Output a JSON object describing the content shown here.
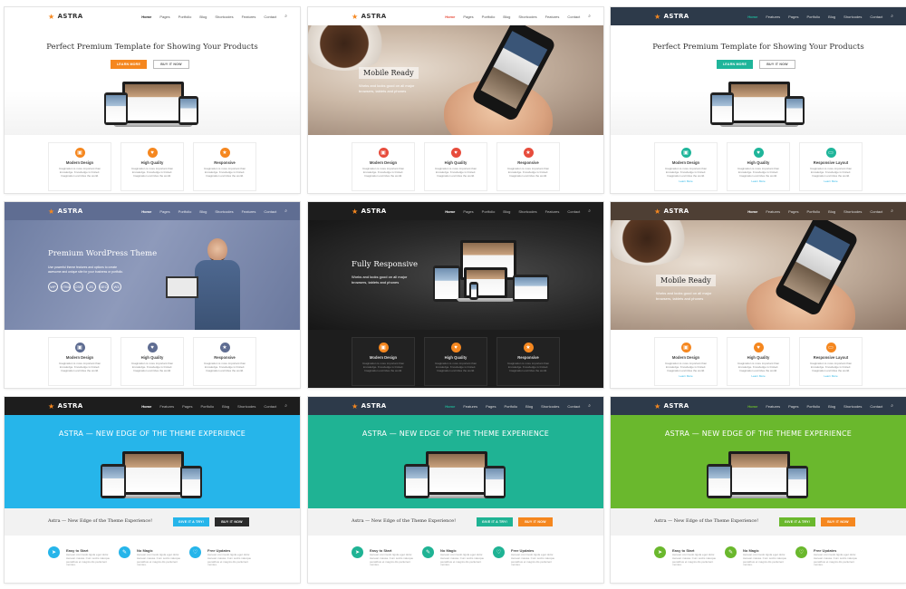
{
  "common": {
    "logo": "ASTRA",
    "menu": [
      "Home",
      "Pages",
      "Portfolio",
      "Blog",
      "Shortcodes",
      "Features",
      "Contact"
    ],
    "menu_b": [
      "Home",
      "Features",
      "Pages",
      "Portfolio",
      "Blog",
      "Shortcodes",
      "Contact"
    ],
    "feature_desc": "Imagination is more important than knowledge. Knowledge is limited. Imagination encircles the world.",
    "read_more": "Learn More"
  },
  "card1": {
    "title": "Perfect Premium Template for Showing Your Products",
    "btn_primary": "LEARN MORE",
    "btn_secondary": "BUY IT NOW",
    "features": [
      "Modern Design",
      "High Quality",
      "Responsive"
    ]
  },
  "card2": {
    "overlay_title": "Mobile Ready",
    "overlay_desc": "Works and looks good on all major browsers, tablets and phones",
    "features": [
      "Modern Design",
      "High Quality",
      "Responsive"
    ]
  },
  "card3": {
    "title": "Perfect Premium Template for Showing Your Products",
    "btn_primary": "LEARN MORE",
    "btn_secondary": "BUY IT NOW",
    "features": [
      "Modern Design",
      "High Quality",
      "Responsive Layout"
    ]
  },
  "card4": {
    "title": "Premium WordPress Theme",
    "desc": "Use powerful theme features and options to create awesome and unique site for your business or portfolio.",
    "icon_labels": [
      "WP",
      "HTML",
      "CSS",
      "JS",
      "SEO",
      "W3"
    ],
    "features": [
      "Modern Design",
      "High Quality",
      "Responsive"
    ]
  },
  "card5": {
    "title": "Fully Responsive",
    "desc": "Works and looks good on all major browsers, tablets and phones",
    "features": [
      "Modern Design",
      "High Quality",
      "Responsive"
    ]
  },
  "card6": {
    "overlay_title": "Mobile Ready",
    "overlay_desc": "Works and looks good on all major browsers, tablets and phones",
    "features": [
      "Modern Design",
      "High Quality",
      "Responsive Layout"
    ]
  },
  "edge_cards": {
    "title": "ASTRA — NEW EDGE OF THE THEME EXPERIENCE",
    "cta_text": "Astra — New Edge of the Theme Experience!",
    "btn_try": "GIVE IT A TRY!",
    "btn_buy": "BUY IT NOW",
    "features": [
      "Easy to Start",
      "No Magic",
      "Free Updates"
    ],
    "feature_desc": "Aenean commodo ligula eget dolor. Aenean massa. Cum sociis natoque penatibus et magnis dis parturient montes."
  },
  "colors": {
    "orange": "#f5871f",
    "teal": "#1fb59a",
    "blue_slate": "#5f6d92",
    "dark": "#1d1d1d",
    "dark_nav": "#2d3a4a",
    "cyan": "#26b5ea",
    "green_teal": "#1fb394",
    "lime": "#6ab82d",
    "brown_nav": "#4e3f34",
    "red": "#e74c3c"
  }
}
